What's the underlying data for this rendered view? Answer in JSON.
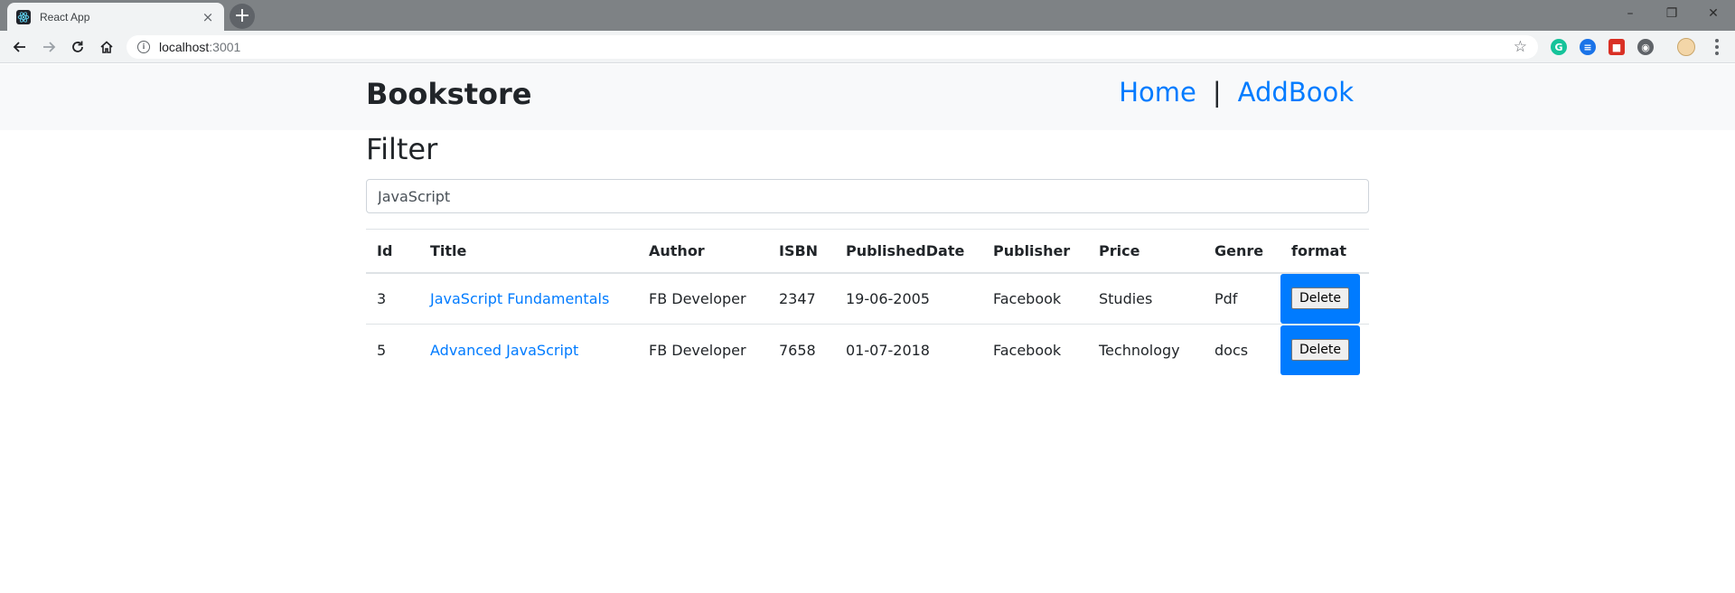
{
  "browser": {
    "tab_title": "React App",
    "tab_close": "×",
    "new_tab": "+",
    "url_host": "localhost",
    "url_port": ":3001",
    "window_controls": [
      "–",
      "❐",
      "✕"
    ],
    "extensions": [
      {
        "name": "grammarly-icon",
        "color": "#15c39a",
        "glyph": "G"
      },
      {
        "name": "extension-blue-icon",
        "color": "#1a73e8",
        "glyph": "≡"
      },
      {
        "name": "extension-red-icon",
        "color": "#d93025",
        "glyph": "■"
      },
      {
        "name": "extension-target-icon",
        "color": "#5f6368",
        "glyph": "◉"
      }
    ]
  },
  "navbar": {
    "brand": "Bookstore",
    "links": [
      "Home",
      "AddBook"
    ],
    "separator": "|"
  },
  "filter": {
    "heading": "Filter",
    "value": "JavaScript"
  },
  "table": {
    "headers": [
      "Id",
      "Title",
      "Author",
      "ISBN",
      "PublishedDate",
      "Publisher",
      "Price",
      "Genre",
      "format"
    ],
    "rows": [
      {
        "id": "3",
        "title": "JavaScript Fundamentals",
        "author": "FB Developer",
        "isbn": "2347",
        "date": "19-06-2005",
        "publisher": "Facebook",
        "price": "Studies",
        "genre": "Pdf",
        "action": "Delete"
      },
      {
        "id": "5",
        "title": "Advanced JavaScript",
        "author": "FB Developer",
        "isbn": "7658",
        "date": "01-07-2018",
        "publisher": "Facebook",
        "price": "Technology",
        "genre": "docs",
        "action": "Delete"
      }
    ]
  },
  "colors": {
    "accent": "#007bff",
    "navbar_bg": "#f8f9fa"
  }
}
